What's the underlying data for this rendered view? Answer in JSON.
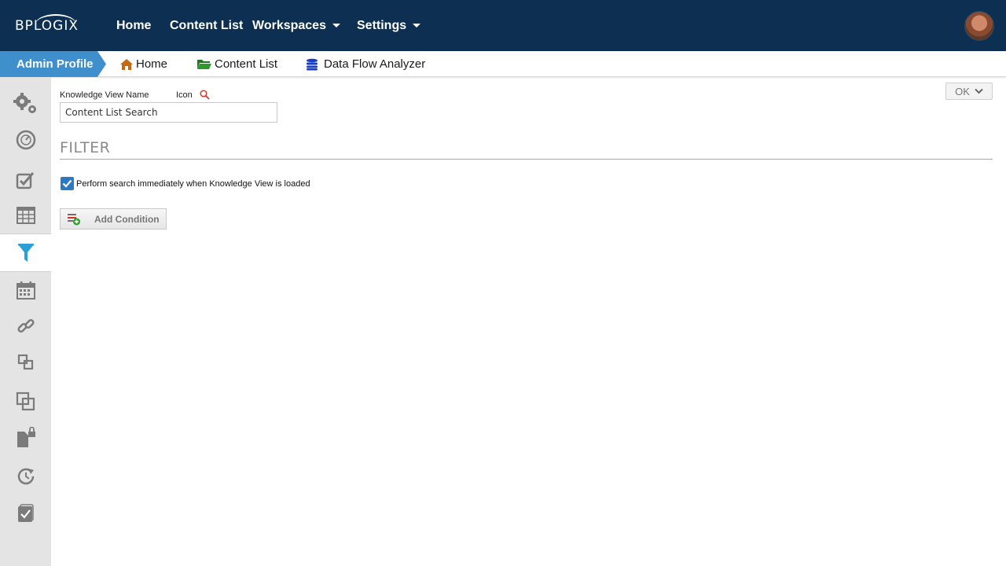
{
  "header": {
    "logo_text": "BPLOGIX",
    "nav": [
      {
        "label": "Home"
      },
      {
        "label": "Content List"
      },
      {
        "label": "Workspaces"
      },
      {
        "label": "Settings"
      }
    ]
  },
  "breadcrumb": {
    "active": "Admin Profile",
    "items": [
      {
        "label": "Home",
        "icon": "home-icon"
      },
      {
        "label": "Content List",
        "icon": "folder-icon"
      },
      {
        "label": "Data Flow Analyzer",
        "icon": "database-icon"
      }
    ]
  },
  "sidebar": {
    "items": [
      {
        "icon": "gears-icon"
      },
      {
        "icon": "dashboard-gauge-icon"
      },
      {
        "icon": "checkbox-edit-icon"
      },
      {
        "icon": "table-icon"
      },
      {
        "icon": "filter-icon",
        "active": true
      },
      {
        "icon": "calendar-icon"
      },
      {
        "icon": "link-icon"
      },
      {
        "icon": "move-icon"
      },
      {
        "icon": "clone-icon"
      },
      {
        "icon": "locked-file-icon"
      },
      {
        "icon": "refresh-clock-icon"
      },
      {
        "icon": "task-checklist-icon"
      }
    ]
  },
  "form": {
    "name_label": "Knowledge View Name",
    "icon_label": "Icon",
    "name_value": "Content List Search",
    "ok_label": "OK",
    "section_title": "FILTER",
    "checkbox_label": "Perform search immediately when Knowledge View is loaded",
    "checkbox_checked": true,
    "add_condition_label": "Add Condition"
  },
  "colors": {
    "header_bg": "#0c2f52",
    "admin_tab": "#3f8fcd",
    "accent": "#2b78c5",
    "sidebar_bg": "#e4e4e4",
    "filter_icon": "#2a9fd6"
  }
}
